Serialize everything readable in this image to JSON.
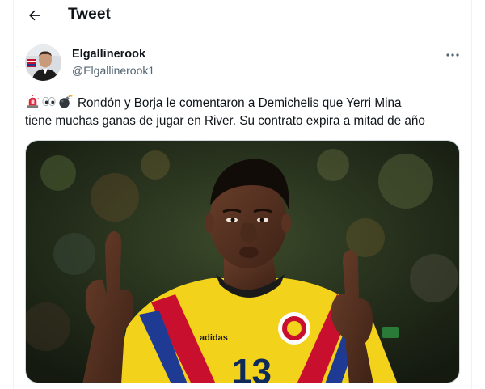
{
  "header": {
    "title": "Tweet",
    "back_icon": "arrow-left-icon"
  },
  "tweet": {
    "author": {
      "display_name": "Elgallinerook",
      "handle": "@Elgallinerook1"
    },
    "more_icon": "more-horizontal-icon",
    "emojis": [
      "rotating-light-icon",
      "eyes-icon",
      "bomb-icon"
    ],
    "text_line1": "Rondón y Borja le comentaron a Demichelis que Yerri Mina",
    "text_line2": "tiene muchas ganas de jugar en River. Su contrato expira a mitad de año",
    "image": {
      "jersey_brand": "adidas",
      "jersey_number": "13",
      "colors": {
        "jersey": "#f2d21b",
        "stripe_red": "#c8102e",
        "stripe_blue": "#1f3a93",
        "background": "#1c2416"
      }
    }
  },
  "colors": {
    "text_primary": "#0f1419",
    "text_secondary": "#536471",
    "border": "#eff3f4"
  }
}
